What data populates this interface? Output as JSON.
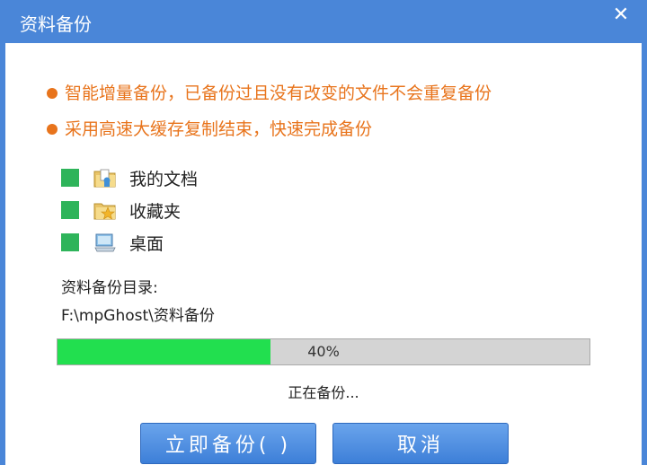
{
  "window": {
    "title": "资料备份",
    "close_symbol": "✕"
  },
  "bullets": [
    "智能增量备份，已备份过且没有改变的文件不会重复备份",
    "采用高速大缓存复制结束，快速完成备份"
  ],
  "items": [
    {
      "label": "我的文档",
      "icon": "documents-folder-icon",
      "checked": true
    },
    {
      "label": "收藏夹",
      "icon": "favorites-folder-icon",
      "checked": true
    },
    {
      "label": "桌面",
      "icon": "desktop-icon",
      "checked": true
    }
  ],
  "directory": {
    "label": "资料备份目录:",
    "path": "F:\\mpGhost\\资料备份"
  },
  "progress": {
    "value": 40,
    "text": "40%"
  },
  "status": "正在备份...",
  "buttons": {
    "backup": "立即备份(  )",
    "cancel": "取消"
  },
  "colors": {
    "titlebar": "#4a86d8",
    "bullet": "#e8741c",
    "checkbox": "#2eb45a",
    "progress_fill": "#22df4f",
    "button": "#3d7fd8"
  }
}
